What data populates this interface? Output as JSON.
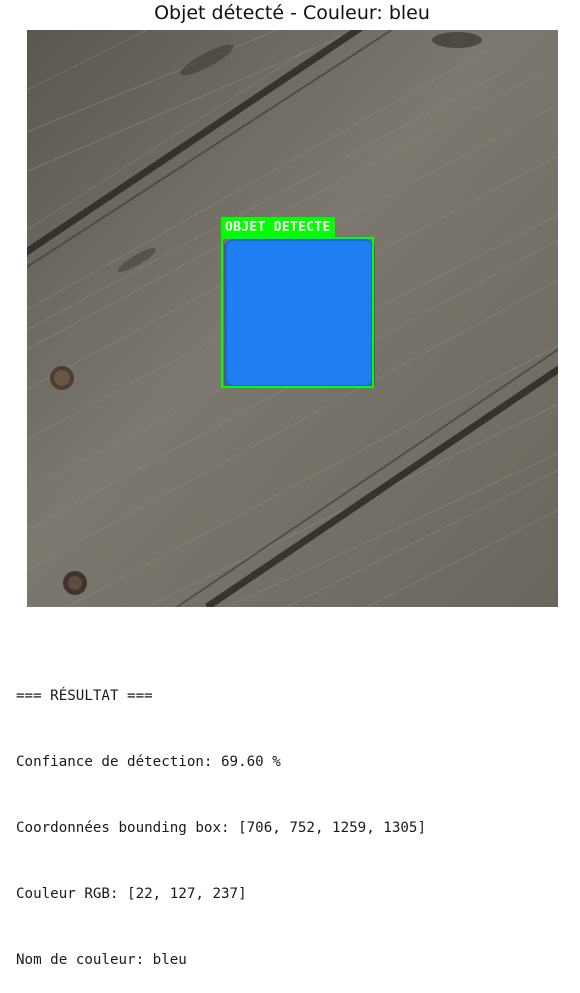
{
  "figure": {
    "title": "Objet détecté - Couleur: bleu",
    "detection_label": "OBJET DETECTE",
    "detected_object_color": "#1f7ff2",
    "box_color": "#00ff00"
  },
  "output": {
    "header": "=== RÉSULTAT ===",
    "confidence": "Confiance de détection: 69.60 %",
    "bbox": "Coordonnées bounding box: [706, 752, 1259, 1305]",
    "rgb": "Couleur RGB: [22, 127, 237]",
    "color_name": "Nom de couleur: bleu"
  }
}
